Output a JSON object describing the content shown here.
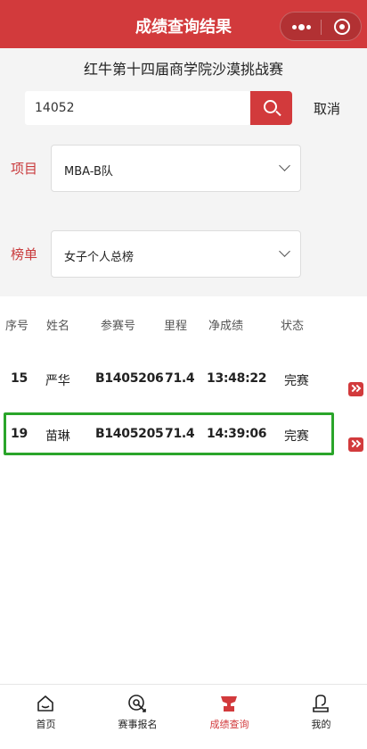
{
  "window": {
    "title": "成绩查询结果"
  },
  "event": {
    "title": "红牛第十四届商学院沙漠挑战赛"
  },
  "search": {
    "value": "14052",
    "cancel_label": "取消"
  },
  "filters": {
    "project_label": "项目",
    "project_value": "MBA-B队",
    "board_label": "榜单",
    "board_value": "女子个人总榜"
  },
  "table": {
    "headers": [
      "序号",
      "姓名",
      "参赛号",
      "里程",
      "净成绩",
      "状态"
    ],
    "rows": [
      {
        "rank": "15",
        "name": "严华",
        "bib": "B1405206",
        "distance": "71.4",
        "time": "13:48:22",
        "status": "完赛"
      },
      {
        "rank": "19",
        "name": "苗琳",
        "bib": "B1405205",
        "distance": "71.4",
        "time": "14:39:06",
        "status": "完赛"
      }
    ]
  },
  "tabbar": {
    "items": [
      {
        "label": "首页",
        "icon": "home-icon"
      },
      {
        "label": "赛事报名",
        "icon": "register-icon"
      },
      {
        "label": "成绩查询",
        "icon": "trophy-icon"
      },
      {
        "label": "我的",
        "icon": "profile-icon"
      }
    ],
    "active_index": 2
  },
  "colors": {
    "brand": "#d23a3c",
    "highlight": "#2aa52a"
  }
}
